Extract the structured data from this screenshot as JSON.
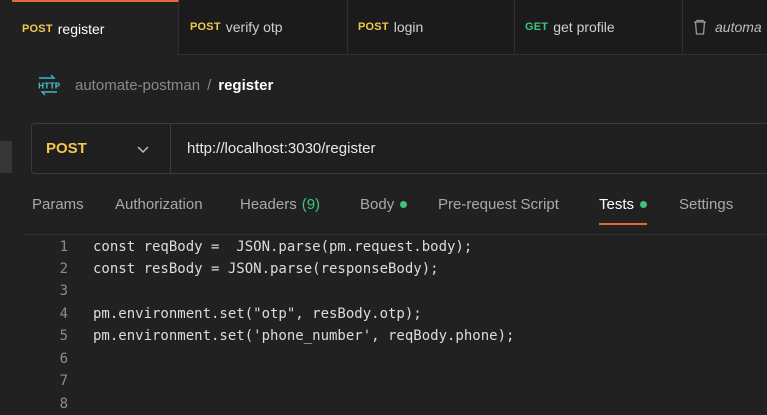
{
  "tabs": [
    {
      "method": "POST",
      "name": "register",
      "active": true
    },
    {
      "method": "POST",
      "name": "verify otp",
      "active": false
    },
    {
      "method": "POST",
      "name": "login",
      "active": false
    },
    {
      "method": "GET",
      "name": "get profile",
      "active": false
    },
    {
      "method": "",
      "name": "automa",
      "active": false
    }
  ],
  "breadcrumb": {
    "icon": "http-icon",
    "collection": "automate-postman",
    "separator": "/",
    "request": "register"
  },
  "request": {
    "method": "POST",
    "url": "http://localhost:3030/register"
  },
  "request_tabs": {
    "params": "Params",
    "authorization": "Authorization",
    "headers": "Headers",
    "headers_count": "(9)",
    "body": "Body",
    "pre_request": "Pre-request Script",
    "tests": "Tests",
    "settings": "Settings",
    "active": "Tests"
  },
  "editor": {
    "lines": [
      {
        "n": "1",
        "code": "const reqBody =  JSON.parse(pm.request.body);"
      },
      {
        "n": "2",
        "code": "const resBody = JSON.parse(responseBody);"
      },
      {
        "n": "3",
        "code": ""
      },
      {
        "n": "4",
        "code": "pm.environment.set(\"otp\", resBody.otp);"
      },
      {
        "n": "5",
        "code": "pm.environment.set('phone_number', reqBody.phone);"
      },
      {
        "n": "6",
        "code": ""
      },
      {
        "n": "7",
        "code": ""
      },
      {
        "n": "8",
        "code": ""
      }
    ]
  },
  "colors": {
    "accent": "#e46a3d",
    "post": "#f2c94c",
    "get": "#3fc47c",
    "indicator": "#3fc47c"
  }
}
